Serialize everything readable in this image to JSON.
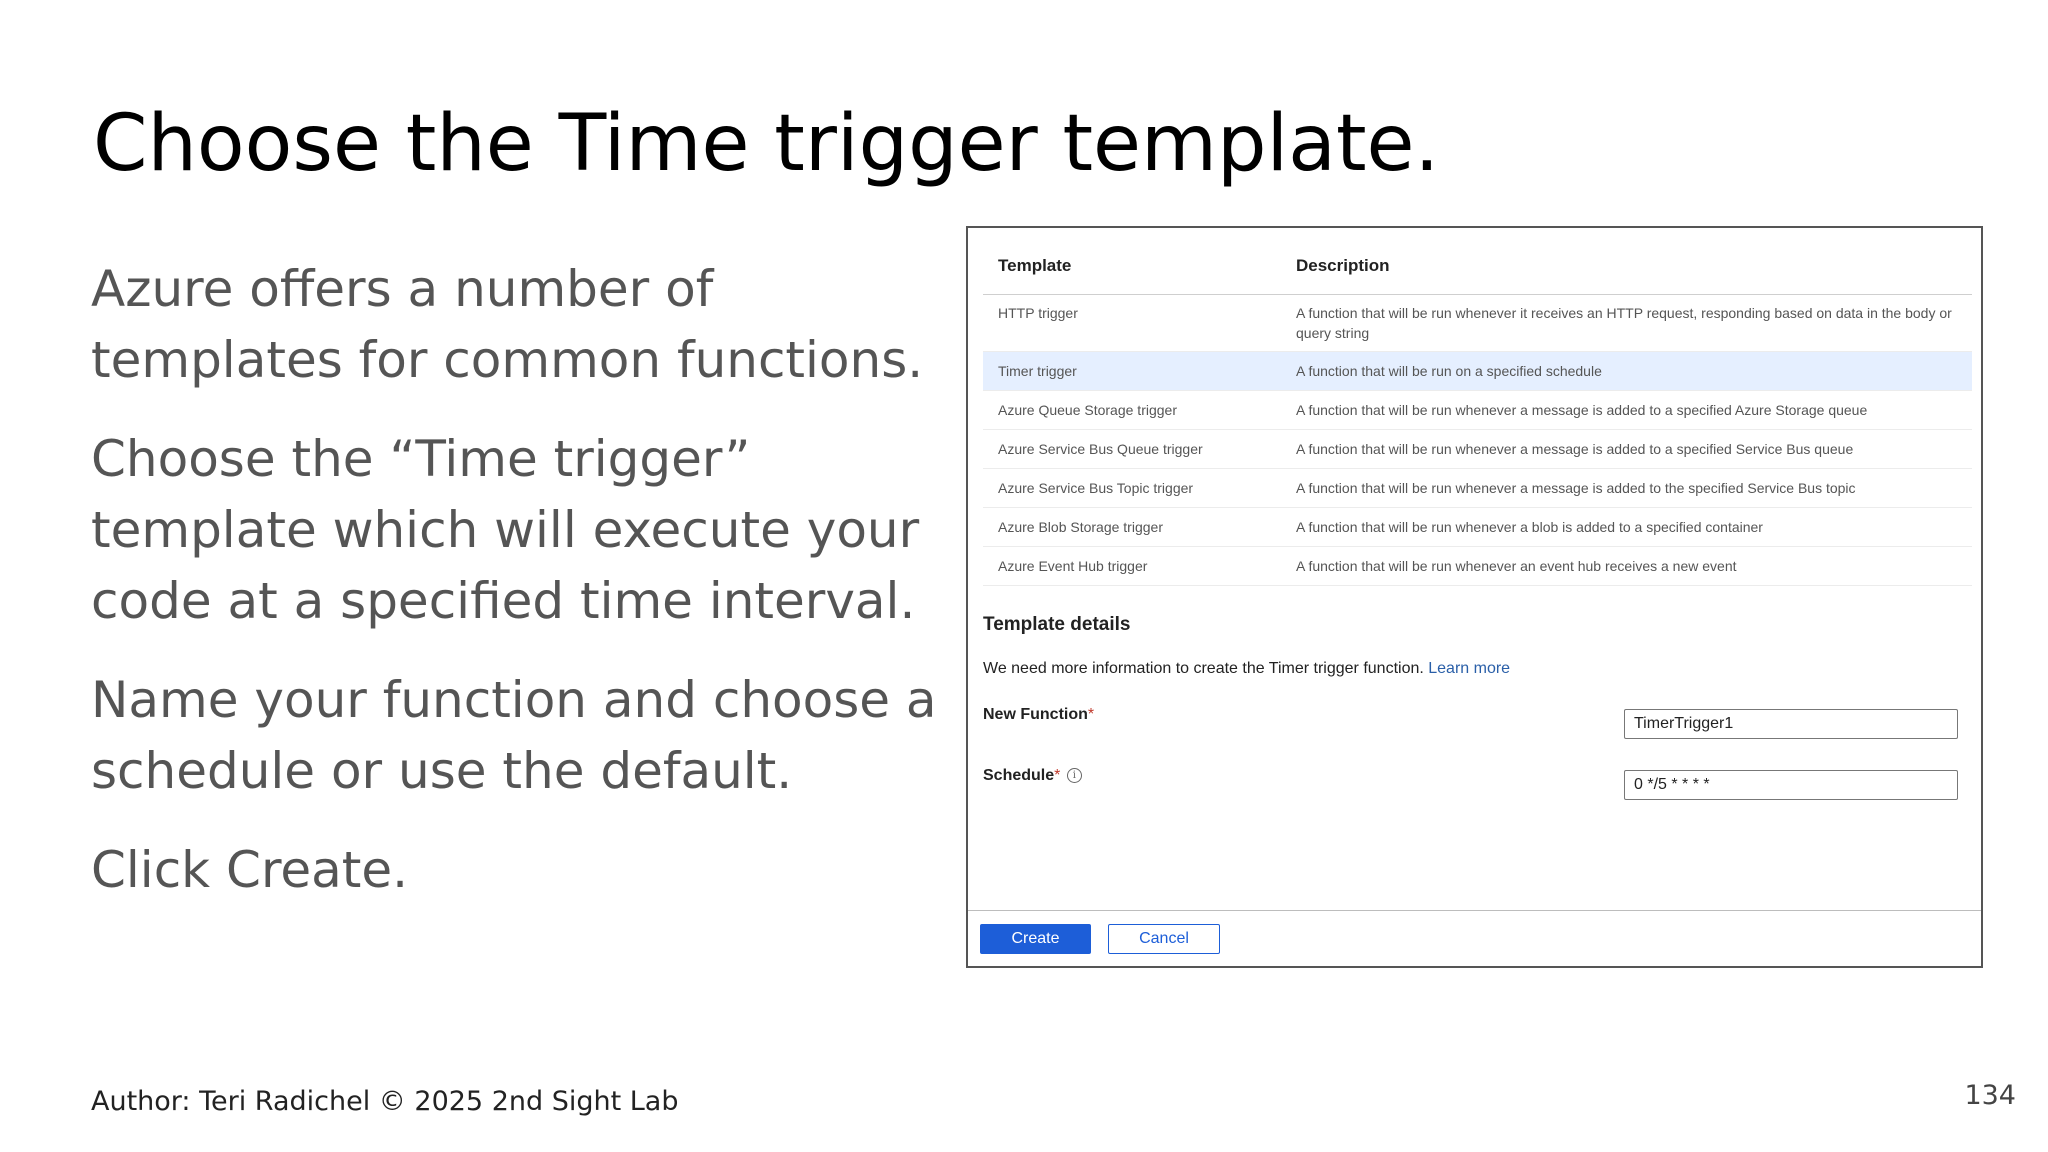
{
  "slide": {
    "title": "Choose the Time trigger template.",
    "bullets": [
      "Azure offers a number of templates for common functions.",
      "Choose the “Time trigger” template which will execute your code at a specified time interval.",
      "Name your function and choose a schedule or use the default.",
      "Click Create."
    ],
    "footer": "Author: Teri Radichel © 2025 2nd Sight Lab",
    "page_number": "134"
  },
  "panel": {
    "table": {
      "headers": {
        "template": "Template",
        "description": "Description"
      },
      "rows": [
        {
          "template": "HTTP trigger",
          "description": "A function that will be run whenever it receives an HTTP request, responding based on data in the body or query string",
          "selected": false
        },
        {
          "template": "Timer trigger",
          "description": "A function that will be run on a specified schedule",
          "selected": true
        },
        {
          "template": "Azure Queue Storage trigger",
          "description": "A function that will be run whenever a message is added to a specified Azure Storage queue",
          "selected": false
        },
        {
          "template": "Azure Service Bus Queue trigger",
          "description": "A function that will be run whenever a message is added to a specified Service Bus queue",
          "selected": false
        },
        {
          "template": "Azure Service Bus Topic trigger",
          "description": "A function that will be run whenever a message is added to the specified Service Bus topic",
          "selected": false
        },
        {
          "template": "Azure Blob Storage trigger",
          "description": "A function that will be run whenever a blob is added to a specified container",
          "selected": false
        },
        {
          "template": "Azure Event Hub trigger",
          "description": "A function that will be run whenever an event hub receives a new event",
          "selected": false
        }
      ]
    },
    "details": {
      "heading": "Template details",
      "text": "We need more information to create the Timer trigger function. ",
      "learn_more": "Learn more",
      "new_function_label": "New Function",
      "new_function_value": "TimerTrigger1",
      "schedule_label": "Schedule",
      "schedule_value": "0 */5 * * * *",
      "required_mark": "*",
      "info_glyph": "i"
    },
    "buttons": {
      "create": "Create",
      "cancel": "Cancel"
    },
    "colors": {
      "primary": "#1d5ed8",
      "selected_row": "#e5efff",
      "required": "#c0392b",
      "link": "#2a5fa8"
    }
  }
}
